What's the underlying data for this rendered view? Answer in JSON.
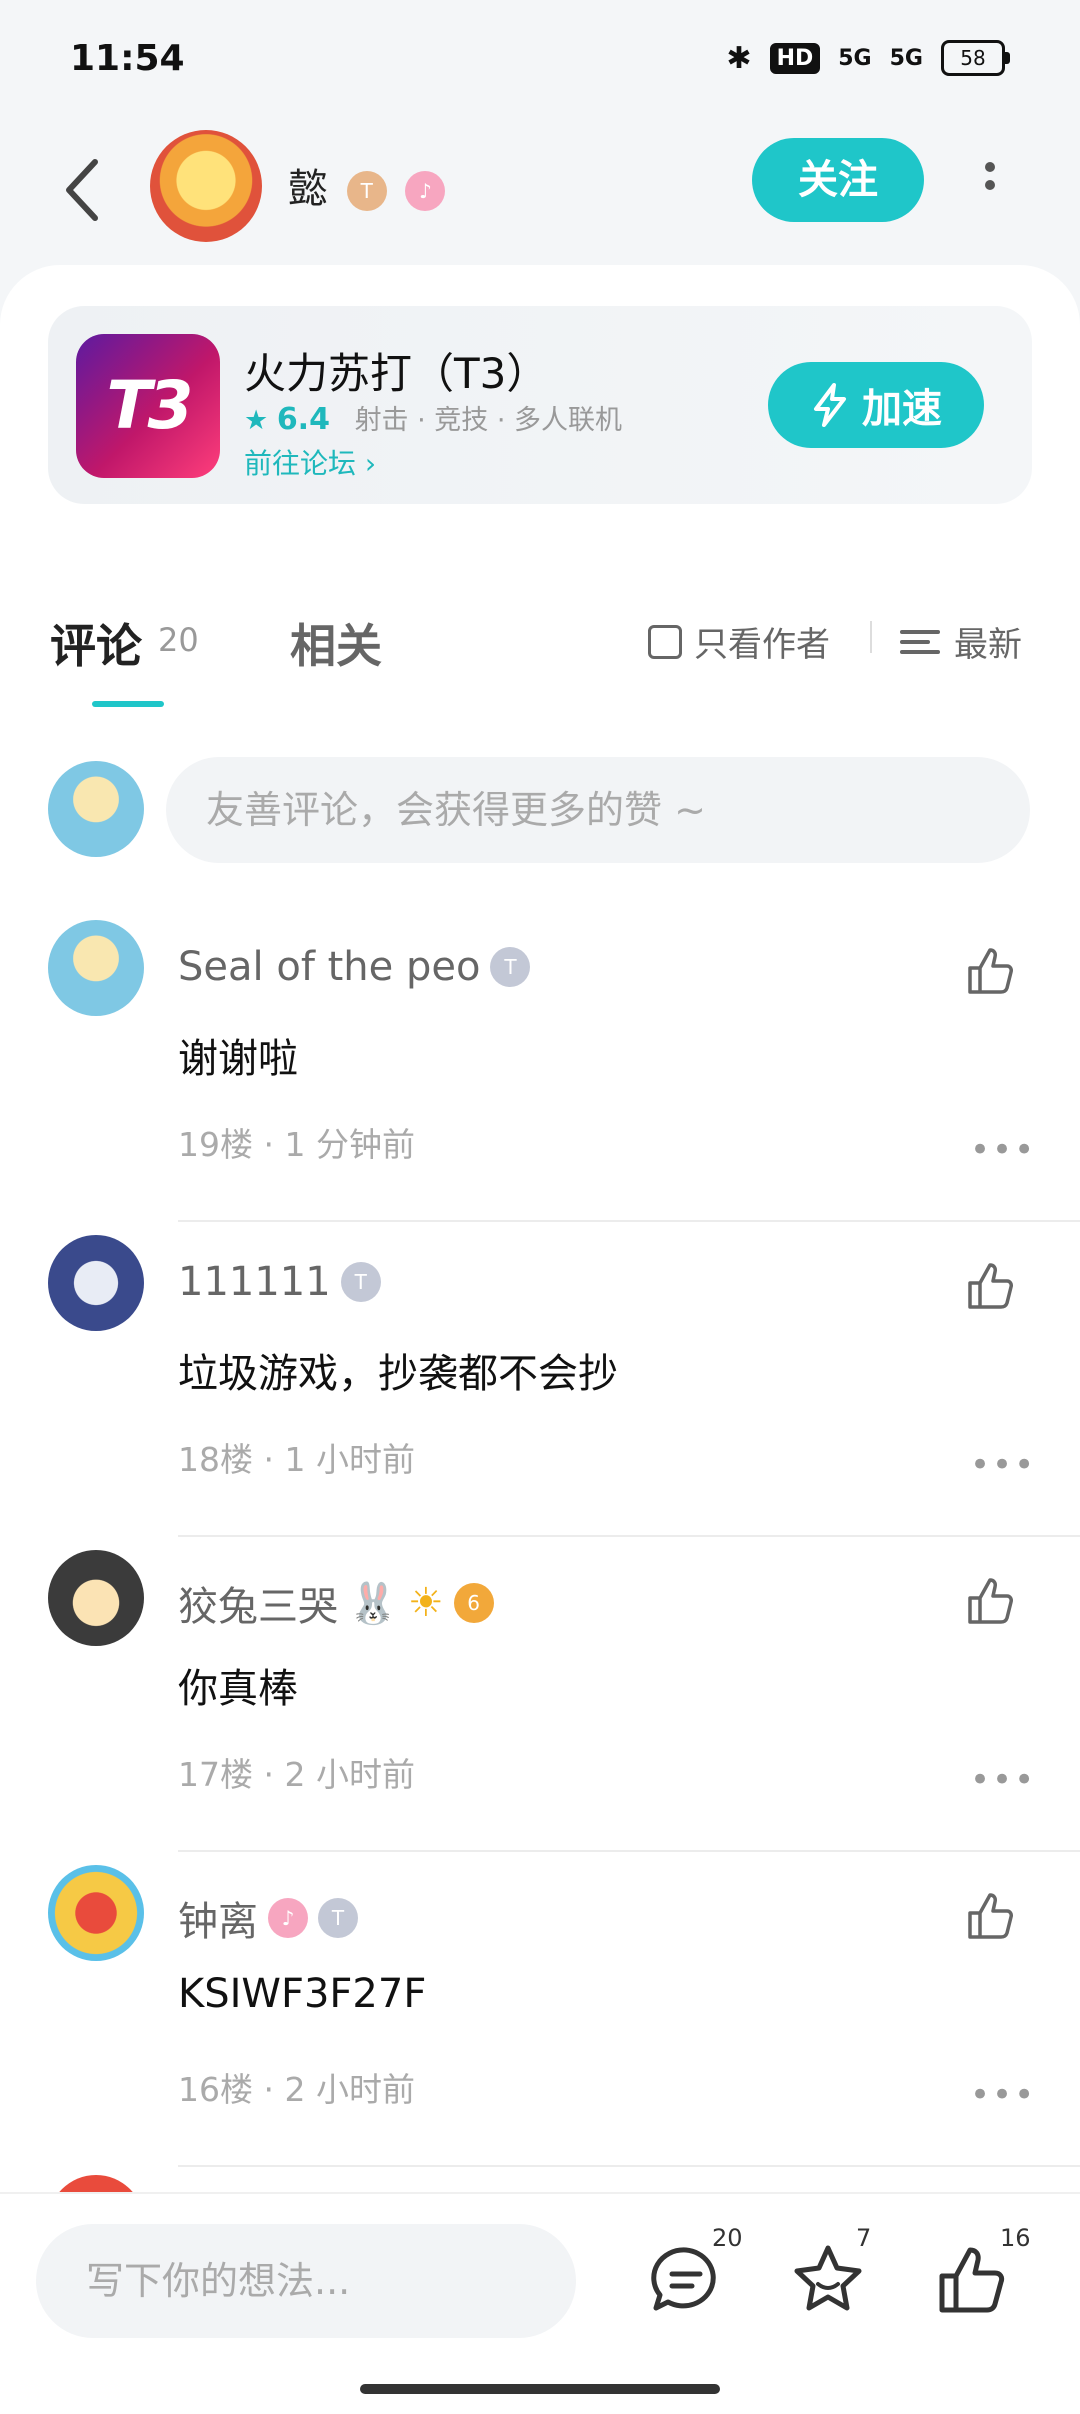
{
  "status_bar": {
    "time": "11:54",
    "bluetooth": "✱",
    "hd": "HD",
    "signal_1": "5G",
    "signal_2": "5G",
    "battery": "58"
  },
  "header": {
    "author_name": "懿",
    "badge_1": "T",
    "badge_2": "♪",
    "follow_label": "关注"
  },
  "game": {
    "icon_text": "T3",
    "name": "火力苏打（T3）",
    "score": "6.4",
    "tags": "射击 · 竞技 · 多人联机",
    "forum_link": "前往论坛",
    "speed_label": "加速"
  },
  "tabs": {
    "comments_label": "评论",
    "comments_count": "20",
    "related_label": "相关",
    "only_author_label": "只看作者",
    "sort_label": "最新"
  },
  "composer": {
    "placeholder": "友善评论，会获得更多的赞 ~"
  },
  "comments": [
    {
      "name": "Seal of the peo",
      "badge": "T",
      "text": "谢谢啦",
      "meta": "19楼 · 1 分钟前"
    },
    {
      "name": "111111",
      "badge": "T",
      "text": "垃圾游戏，抄袭都不会抄",
      "meta": "18楼 · 1 小时前"
    },
    {
      "name": "狡兔三哭",
      "badge": "🐰",
      "badge_2": "☀",
      "badge_3": "6",
      "text": "你真棒",
      "meta": "17楼 · 2 小时前"
    },
    {
      "name": "钟离",
      "badge": "♪",
      "badge_2": "T",
      "text": "KSIWF3F27F",
      "meta": "16楼 · 2 小时前"
    }
  ],
  "bottom_bar": {
    "write_placeholder": "写下你的想法...",
    "comment_count": "20",
    "favorite_count": "7",
    "like_count": "16"
  },
  "colors": {
    "accent": "#1fc6c9",
    "background": "#f4f6f8"
  }
}
